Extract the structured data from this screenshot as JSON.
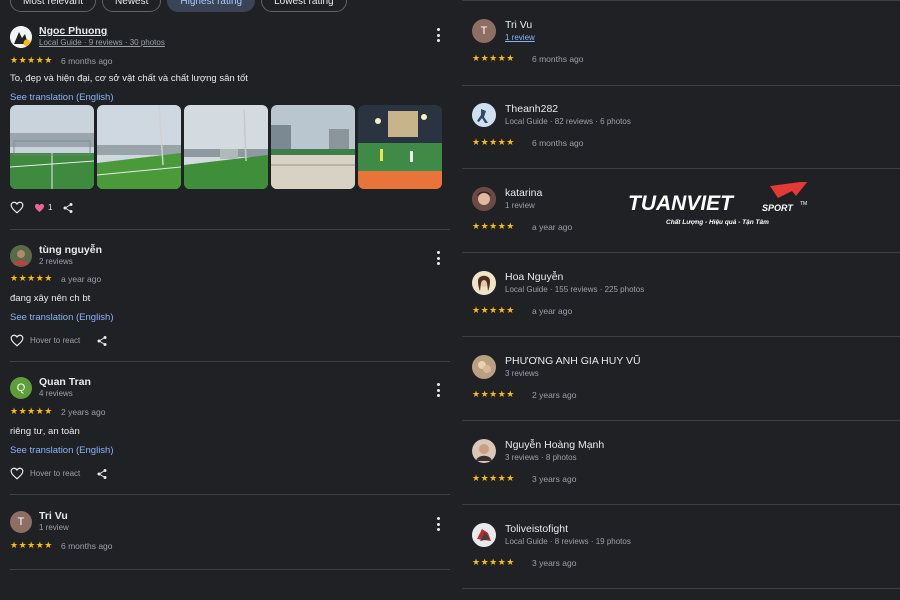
{
  "filters": [
    {
      "label": "Most relevant"
    },
    {
      "label": "Newest"
    },
    {
      "label": "Highest rating"
    },
    {
      "label": "Lowest rating"
    }
  ],
  "left_reviews": [
    {
      "name": "Ngoc Phuong",
      "meta": "Local Guide · 9 reviews · 30 photos",
      "avatar_color": "#e8eaed",
      "stars": "★★★★★",
      "when": "6 months ago",
      "text": "To, đẹp và hiện đại, cơ sở vật chất và chất lượng sân tốt",
      "translate": "See translation (English)",
      "like_count": "1"
    },
    {
      "name": "tùng nguyễn",
      "meta": "2 reviews",
      "avatar_color": "#4a5a3a",
      "stars": "★★★★★",
      "when": "a year ago",
      "text": "đang xây nên ch bt",
      "translate": "See translation (English)",
      "react_label": "Hover to react"
    },
    {
      "name": "Quan Tran",
      "meta": "4 reviews",
      "avatar_letter": "Q",
      "avatar_color": "#5e9e3a",
      "stars": "★★★★★",
      "when": "2 years ago",
      "text": "riêng tư, an toàn",
      "translate": "See translation (English)",
      "react_label": "Hover to react"
    },
    {
      "name": "Tri Vu",
      "meta": "1 review",
      "avatar_letter": "T",
      "avatar_color": "#8d6e63",
      "stars": "★★★★★",
      "when": "6 months ago"
    }
  ],
  "right_reviews": [
    {
      "name": "Tri Vu",
      "meta": "1 review",
      "avatar_letter": "T",
      "avatar_color": "#8d6e63",
      "stars": "★★★★★",
      "when": "6 months ago"
    },
    {
      "name": "Theanh282",
      "meta": "Local Guide · 82 reviews · 6 photos",
      "avatar_color": "#bcd3e8",
      "stars": "★★★★★",
      "when": "6 months ago"
    },
    {
      "name": "katarina",
      "meta": "1 review",
      "avatar_color": "#7a5a50",
      "stars": "★★★★★",
      "when": "a year ago"
    },
    {
      "name": "Hoa Nguyễn",
      "meta": "Local Guide · 155 reviews · 225 photos",
      "avatar_color": "#d9c9a8",
      "stars": "★★★★★",
      "when": "a year ago"
    },
    {
      "name": "PHƯƠNG ANH GIA HUY VŨ",
      "meta": "3 reviews",
      "avatar_color": "#9e8a70",
      "stars": "★★★★★",
      "when": "2 years ago"
    },
    {
      "name": "Nguyễn Hoàng Mạnh",
      "meta": "3 reviews · 8 photos",
      "avatar_color": "#6d5d55",
      "stars": "★★★★★",
      "when": "3 years ago"
    },
    {
      "name": "Toliveistofight",
      "meta": "Local Guide · 8 reviews · 19 photos",
      "avatar_color": "#c0c4c8",
      "stars": "★★★★★",
      "when": "3 years ago"
    }
  ],
  "logo": {
    "main": "TUANVIET",
    "sub": "SPORT",
    "tm": "TM",
    "tagline": "Chất Lượng - Hiệu quả - Tận Tâm"
  },
  "colors": {
    "background": "#202124",
    "star": "#fbbc04",
    "link": "#8ab4f8",
    "like": "#f06292",
    "logo_red": "#e53935"
  }
}
